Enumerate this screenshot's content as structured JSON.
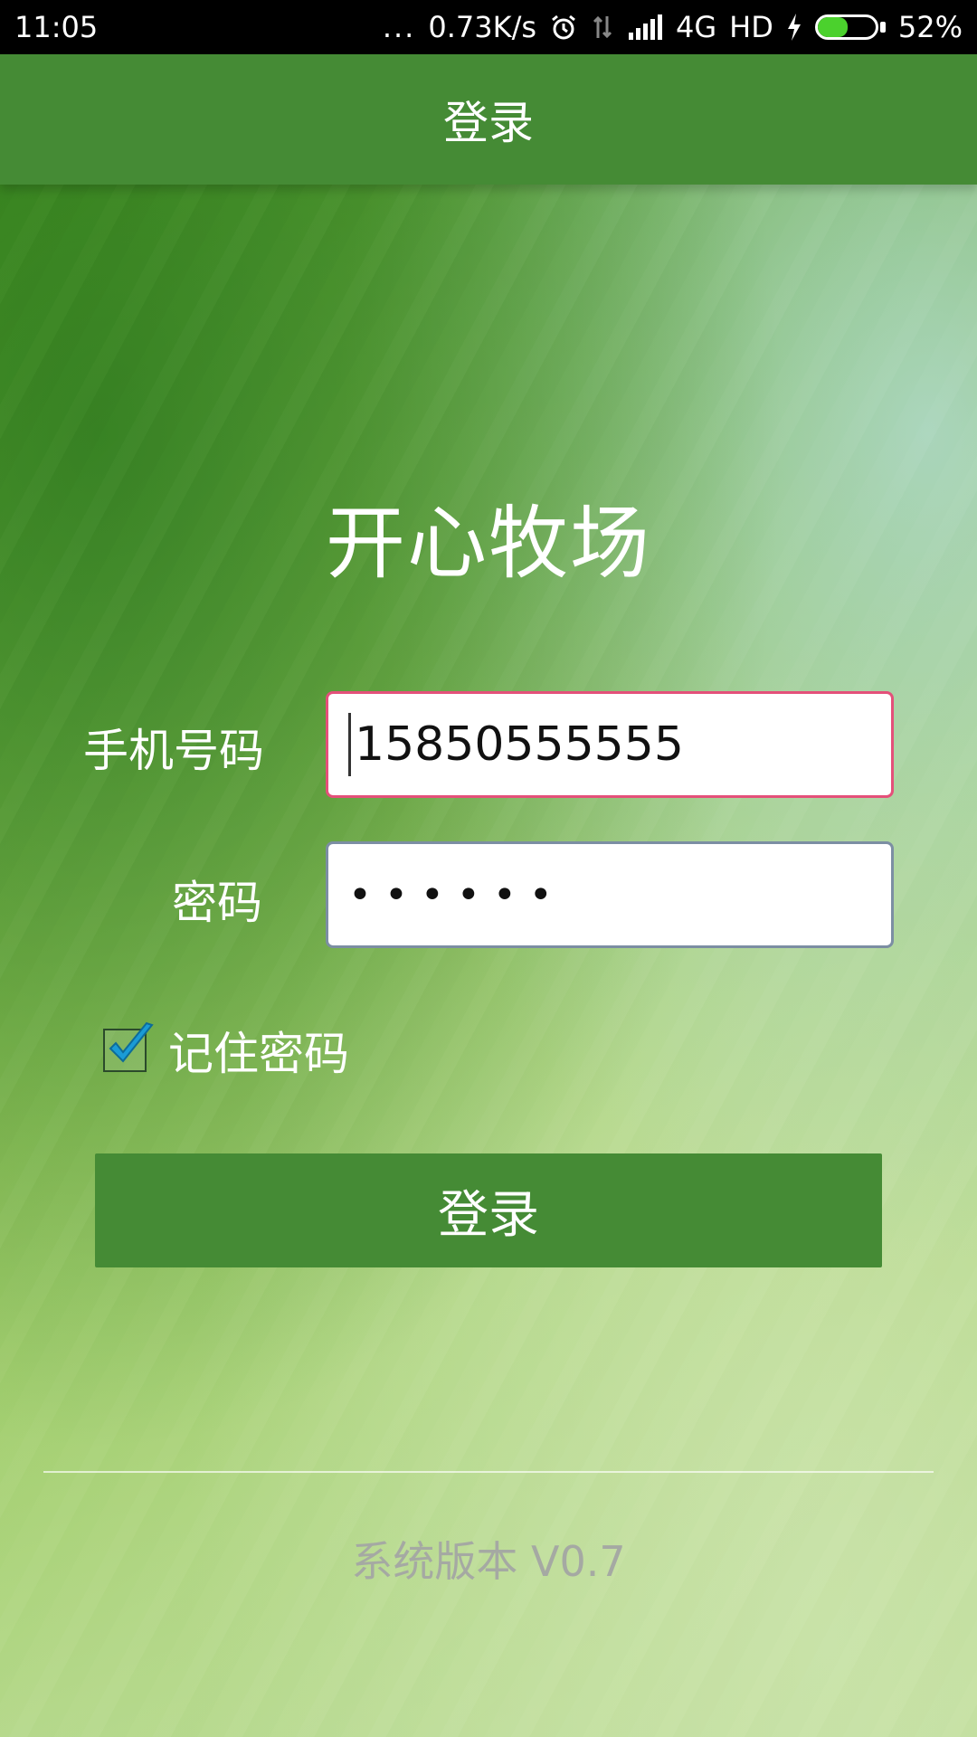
{
  "status_bar": {
    "time": "11:05",
    "dots": "...",
    "net_speed": "0.73K/s",
    "network": "4G",
    "hd": "HD",
    "battery_percent": "52%",
    "battery_level": 0.52,
    "icons": [
      "alarm-icon",
      "data-arrows-icon",
      "signal-icon",
      "charging-icon",
      "battery-icon"
    ]
  },
  "app_bar": {
    "title": "登录"
  },
  "main": {
    "app_title": "开心牧场",
    "phone": {
      "label": "手机号码",
      "value": "15850555555"
    },
    "password": {
      "label": "密码",
      "value": "••••••"
    },
    "remember": {
      "label": "记住密码",
      "checked": true
    },
    "login_button": "登录",
    "version": "系统版本 V0.7"
  },
  "colors": {
    "app_bar": "#458b35",
    "button": "#458b35",
    "focused_border": "#e4507a",
    "checkbox_check": "#1a9bd6",
    "version_text": "#a5a9a3"
  }
}
